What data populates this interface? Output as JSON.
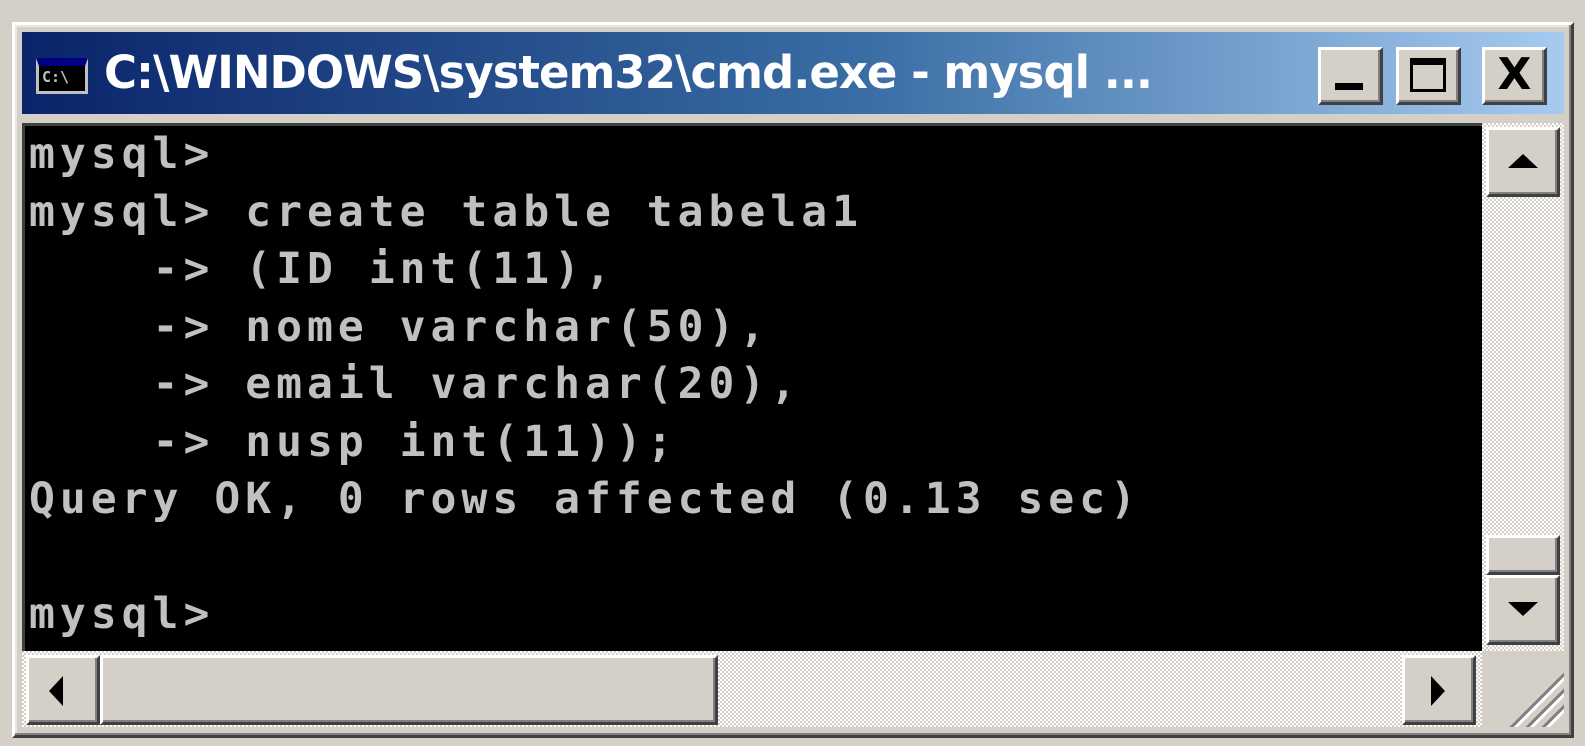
{
  "window": {
    "title": "C:\\WINDOWS\\system32\\cmd.exe - mysql ...",
    "icon": "cmd-console-icon",
    "icon_text": "C:\\",
    "buttons": {
      "minimize_icon": "minimize-icon",
      "maximize_icon": "maximize-icon",
      "close_icon": "close-icon",
      "close_glyph": "X"
    }
  },
  "console": {
    "lines": [
      "mysql>",
      "mysql> create table tabela1",
      "    -> (ID int(11),",
      "    -> nome varchar(50),",
      "    -> email varchar(20),",
      "    -> nusp int(11));",
      "Query OK, 0 rows affected (0.13 sec)",
      "",
      "mysql>"
    ]
  },
  "colors": {
    "console_background": "#000000",
    "console_text": "#c0c0c0",
    "title_gradient_start": "#0a246a",
    "title_gradient_end": "#a6caf0",
    "chrome": "#d4d0c8"
  }
}
